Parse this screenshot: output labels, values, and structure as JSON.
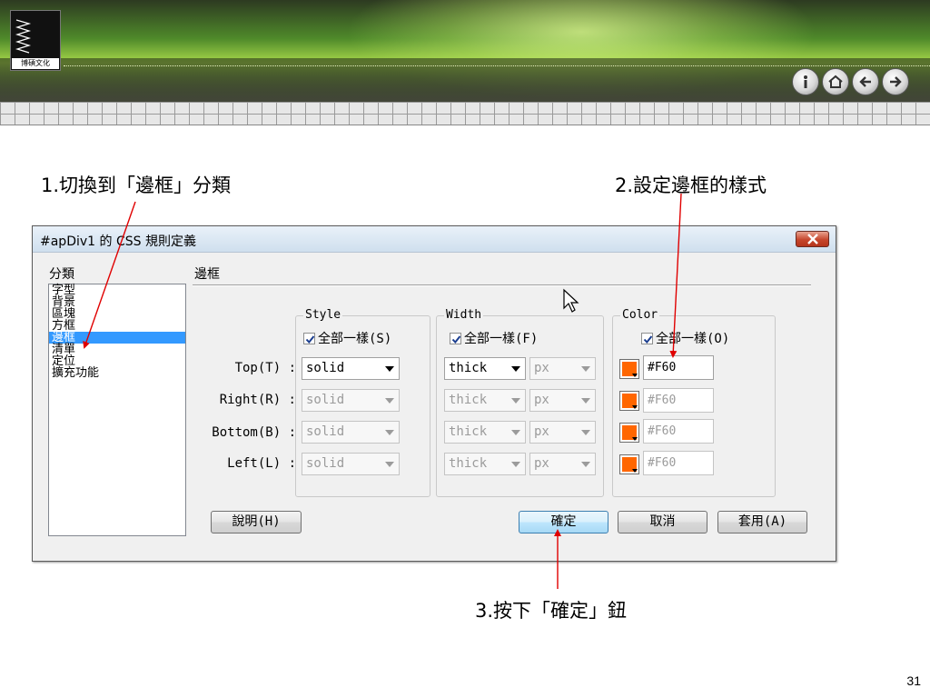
{
  "header": {
    "logo_text": "博碩文化",
    "nav_icons": [
      "info-icon",
      "home-icon",
      "back-icon",
      "forward-icon"
    ]
  },
  "annotations": {
    "step1": "1.切換到「邊框」分類",
    "step2": "2.設定邊框的樣式",
    "step3": "3.按下「確定」鈕",
    "arrow_color": "#e00000"
  },
  "page_number": "31",
  "dialog": {
    "title": "#apDiv1 的 CSS 規則定義",
    "category_label": "分類",
    "categories": [
      {
        "label": "字型"
      },
      {
        "label": "背景"
      },
      {
        "label": "區塊"
      },
      {
        "label": "方框"
      },
      {
        "label": "邊框",
        "selected": true
      },
      {
        "label": "清單"
      },
      {
        "label": "定位"
      },
      {
        "label": "擴充功能"
      }
    ],
    "section_title": "邊框",
    "style_group": {
      "label": "Style",
      "same_all": "全部一樣(S)",
      "checked": true
    },
    "width_group": {
      "label": "Width",
      "same_all": "全部一樣(F)",
      "checked": true
    },
    "color_group": {
      "label": "Color",
      "same_all": "全部一樣(O)",
      "checked": true
    },
    "rows": [
      {
        "label": "Top(T) :",
        "style": "solid",
        "width": "thick",
        "unit": "px",
        "color": "#F60",
        "enabled": true
      },
      {
        "label": "Right(R) :",
        "style": "solid",
        "width": "thick",
        "unit": "px",
        "color": "#F60",
        "enabled": false
      },
      {
        "label": "Bottom(B) :",
        "style": "solid",
        "width": "thick",
        "unit": "px",
        "color": "#F60",
        "enabled": false
      },
      {
        "label": "Left(L) :",
        "style": "solid",
        "width": "thick",
        "unit": "px",
        "color": "#F60",
        "enabled": false
      }
    ],
    "swatch_color": "#ff6600",
    "buttons": {
      "help": "說明(H)",
      "ok": "確定",
      "cancel": "取消",
      "apply": "套用(A)"
    }
  }
}
